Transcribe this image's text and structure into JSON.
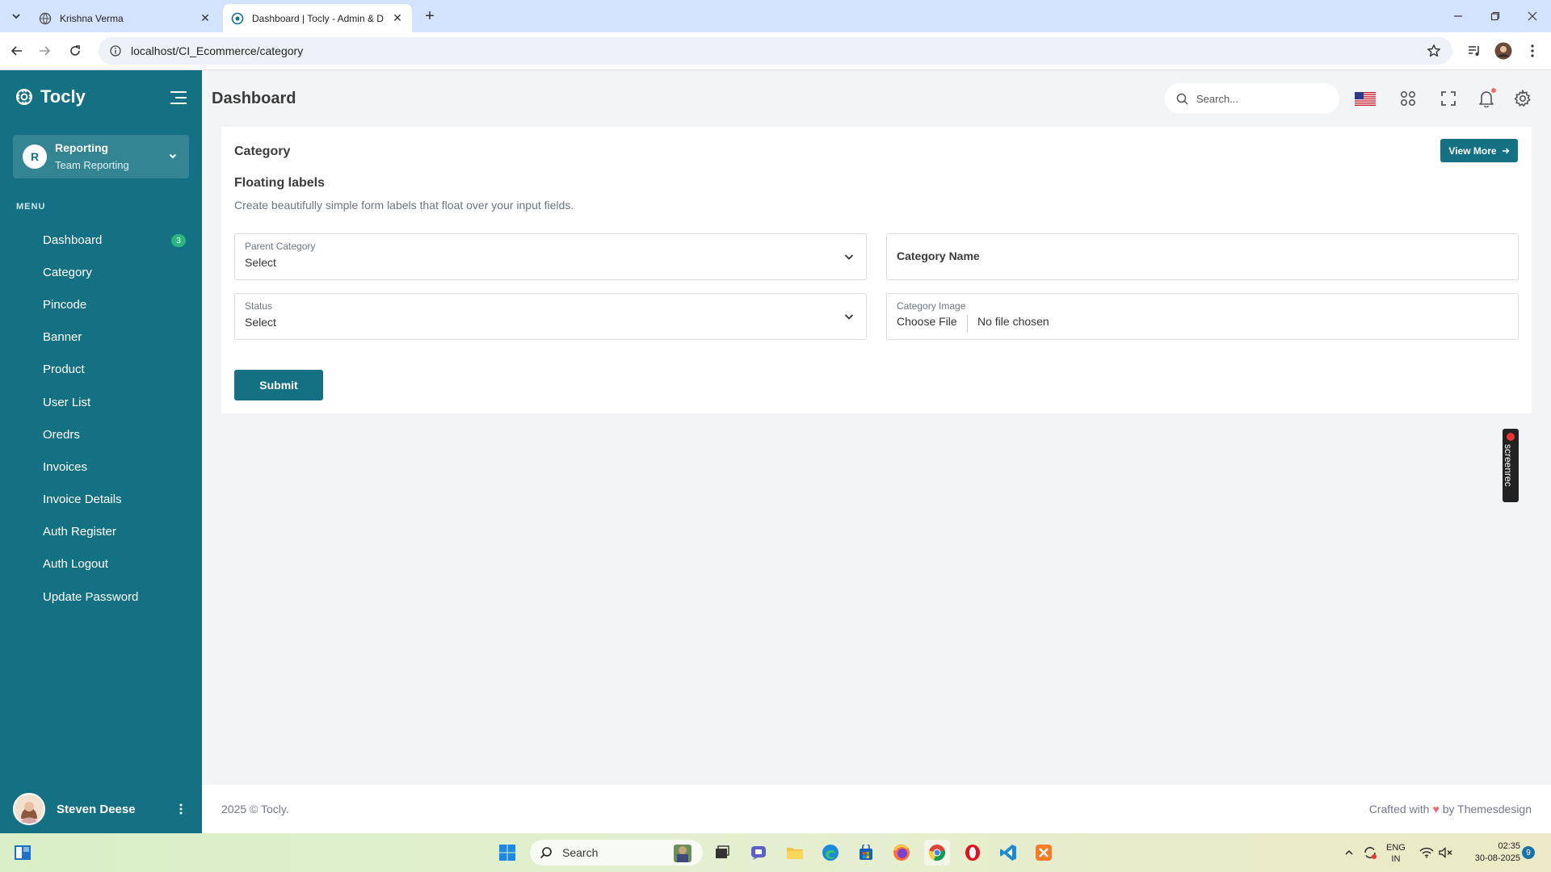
{
  "browser": {
    "tabs": [
      {
        "title": "Krishna Verma",
        "active": false
      },
      {
        "title": "Dashboard | Tocly - Admin & D",
        "active": true
      }
    ],
    "url": "localhost/CI_Ecommerce/category"
  },
  "sidebar": {
    "brand": "Tocly",
    "team": {
      "initial": "R",
      "name": "Reporting",
      "subtitle": "Team Reporting"
    },
    "menu_title": "MENU",
    "items": [
      {
        "label": "Dashboard",
        "badge": "3"
      },
      {
        "label": "Category"
      },
      {
        "label": "Pincode"
      },
      {
        "label": "Banner"
      },
      {
        "label": "Product"
      },
      {
        "label": "User List"
      },
      {
        "label": "Oredrs"
      },
      {
        "label": "Invoices"
      },
      {
        "label": "Invoice Details"
      },
      {
        "label": "Auth Register"
      },
      {
        "label": "Auth Logout"
      },
      {
        "label": "Update Password"
      }
    ],
    "user": {
      "name": "Steven Deese"
    }
  },
  "header": {
    "title": "Dashboard",
    "search_placeholder": "Search..."
  },
  "card": {
    "title": "Category",
    "view_more": "View More",
    "section_title": "Floating labels",
    "section_desc": "Create beautifully simple form labels that float over your input fields.",
    "fields": {
      "parent_category": {
        "label": "Parent Category",
        "value": "Select"
      },
      "category_name": {
        "placeholder": "Category Name"
      },
      "status": {
        "label": "Status",
        "value": "Select"
      },
      "category_image": {
        "label": "Category Image",
        "button": "Choose File",
        "status": "No file chosen"
      }
    },
    "submit": "Submit"
  },
  "overlay": {
    "screenrec": "screenrec"
  },
  "footer": {
    "left": "2025 © Tocly.",
    "crafted": "Crafted with",
    "by": "by Themesdesign"
  },
  "taskbar": {
    "search": "Search",
    "lang1": "ENG",
    "lang2": "IN",
    "time": "02:35",
    "date": "30-08-2025",
    "notifications": "9"
  },
  "colors": {
    "primary": "#137183",
    "badge": "#2ab57d",
    "accent_red": "#f46a6a"
  }
}
